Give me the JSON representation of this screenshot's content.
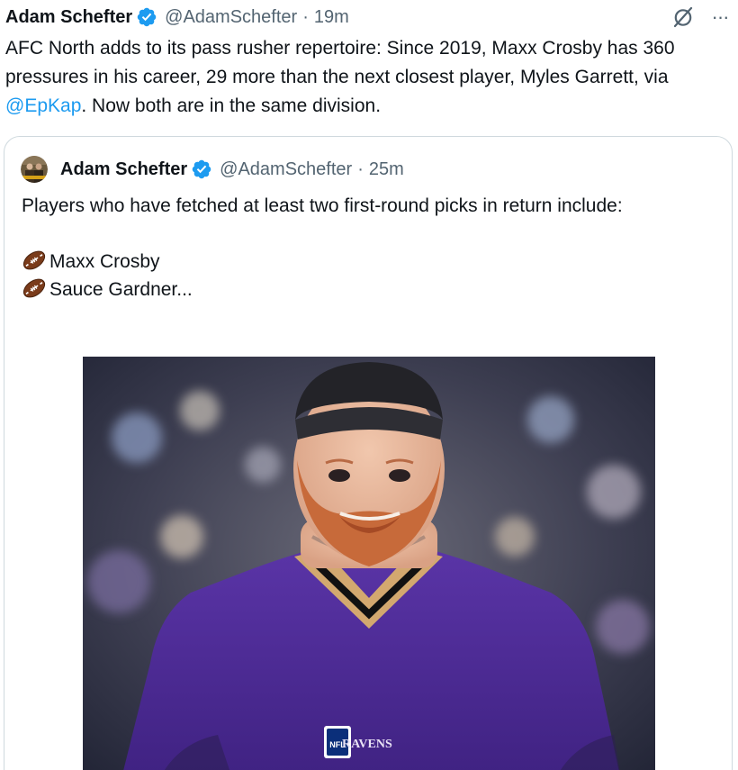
{
  "tweet": {
    "author_name": "Adam Schefter",
    "handle": "@AdamSchefter",
    "separator": "·",
    "time": "19m",
    "text_before_mention": "AFC North adds to its pass rusher repertoire: Since 2019, Maxx Crosby has 360 pressures in his career, 29 more than the next closest player, Myles Garrett, via ",
    "mention": "@EpKap",
    "text_after_mention": ". Now both are in the same division.",
    "more_label": "···"
  },
  "quoted": {
    "author_name": "Adam Schefter",
    "handle": "@AdamSchefter",
    "separator": "·",
    "time": "25m",
    "intro": "Players who have fetched at least two first-round picks in return include:",
    "players": [
      "Maxx Crosby",
      "Sauce Gardner..."
    ],
    "image_jersey_text": "RAVENS",
    "image_logo_text": "NFL"
  },
  "icons": {
    "verified": "verified-badge-icon",
    "grok": "grok-icon",
    "more": "more-options-icon",
    "football": "american-football-emoji"
  },
  "colors": {
    "text_primary": "#0f1419",
    "text_secondary": "#536471",
    "link": "#1d9bf0",
    "border": "#cfd9de",
    "jersey_purple": "#4b2a8f"
  }
}
